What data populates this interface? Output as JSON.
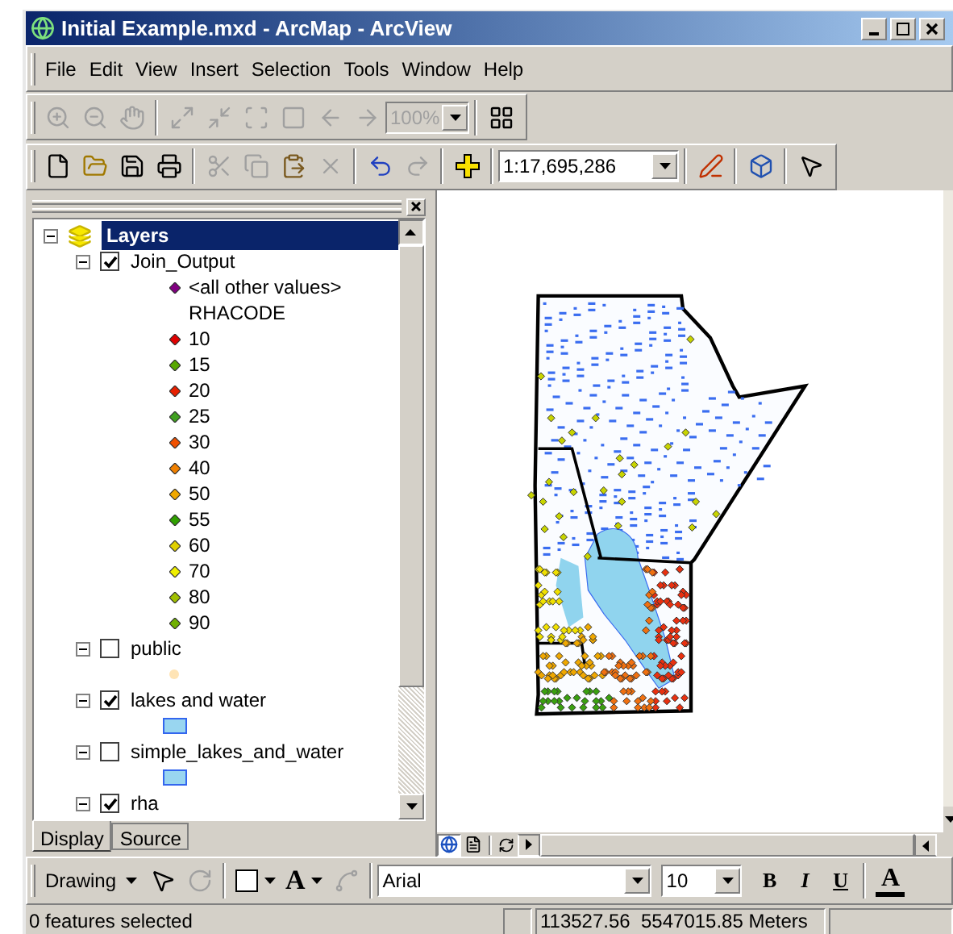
{
  "window": {
    "title": "Initial Example.mxd - ArcMap - ArcView"
  },
  "menu": [
    "File",
    "Edit",
    "View",
    "Insert",
    "Selection",
    "Tools",
    "Window",
    "Help"
  ],
  "tools_toolbar": {
    "buttons": [
      {
        "disabled": true
      },
      {
        "disabled": true
      },
      {
        "disabled": true
      },
      {
        "disabled": true
      },
      {
        "disabled": true
      },
      {
        "disabled": true
      },
      {
        "disabled": true
      },
      {
        "disabled": true
      },
      {
        "disabled": true
      }
    ],
    "zoom_box": {
      "value": "100%",
      "disabled": true
    },
    "layout_button": {
      "disabled": false
    }
  },
  "standard_toolbar": {
    "buttons": [
      {
        "disabled": false
      },
      {
        "disabled": false
      },
      {
        "disabled": false
      },
      {
        "disabled": false
      },
      {
        "disabled": true
      },
      {
        "disabled": true
      },
      {
        "disabled": false
      },
      {
        "disabled": true
      },
      {
        "disabled": false
      },
      {
        "disabled": true
      },
      {
        "disabled": false
      }
    ],
    "scale_box": {
      "value": "1:17,695,286"
    },
    "trailing_buttons": [
      {
        "disabled": false
      },
      {
        "disabled": false
      },
      {
        "disabled": false
      }
    ]
  },
  "toc": {
    "title": "Layers",
    "selected": true,
    "expanded": true,
    "layers": [
      {
        "name": "Join_Output",
        "checked": true,
        "expanded": true,
        "selected": false,
        "legend": [
          {
            "kind": "point",
            "label": "<all other values>",
            "color": "#800080"
          },
          {
            "kind": "heading",
            "label": "RHACODE"
          },
          {
            "kind": "point",
            "label": "10",
            "color": "#e00000"
          },
          {
            "kind": "point",
            "label": "15",
            "color": "#58a800"
          },
          {
            "kind": "point",
            "label": "20",
            "color": "#e82000"
          },
          {
            "kind": "point",
            "label": "25",
            "color": "#40a020"
          },
          {
            "kind": "point",
            "label": "30",
            "color": "#f05000"
          },
          {
            "kind": "point",
            "label": "40",
            "color": "#f08000"
          },
          {
            "kind": "point",
            "label": "50",
            "color": "#f0a800"
          },
          {
            "kind": "point",
            "label": "55",
            "color": "#30a000"
          },
          {
            "kind": "point",
            "label": "60",
            "color": "#e0d000"
          },
          {
            "kind": "point",
            "label": "70",
            "color": "#f0f000"
          },
          {
            "kind": "point",
            "label": "80",
            "color": "#a0c000"
          },
          {
            "kind": "point",
            "label": "90",
            "color": "#70b000"
          }
        ]
      },
      {
        "name": "public",
        "checked": false,
        "expanded": true,
        "selected": false,
        "legend": [
          {
            "kind": "circle",
            "color": "#ffe4b5"
          }
        ]
      },
      {
        "name": "lakes and water",
        "checked": true,
        "expanded": true,
        "selected": false,
        "legend": [
          {
            "kind": "fill",
            "color": "#99d6f0"
          }
        ]
      },
      {
        "name": "simple_lakes_and_water",
        "checked": false,
        "expanded": true,
        "selected": false,
        "legend": [
          {
            "kind": "fill",
            "color": "#99d6f0"
          }
        ]
      },
      {
        "name": "rha",
        "checked": true,
        "expanded": true,
        "selected": false
      }
    ]
  },
  "toc_tabs": [
    {
      "label": "Display",
      "selected": true
    },
    {
      "label": "Source",
      "selected": false
    }
  ],
  "map_views": [
    {
      "selected": true
    },
    {
      "selected": false
    }
  ],
  "drawing_toolbar": {
    "menu": "Drawing",
    "tools": [
      {
        "disabled": false
      },
      {
        "disabled": true
      }
    ],
    "text_glyph": "A",
    "vertex_tool": {
      "disabled": true
    },
    "font": "Arial",
    "font_size": "10",
    "format_buttons": [
      "B",
      "I",
      "U"
    ],
    "font_color_glyph": "A"
  },
  "status": {
    "message": "0 features selected",
    "coordinates": "113527.56  5547015.85 Meters"
  }
}
